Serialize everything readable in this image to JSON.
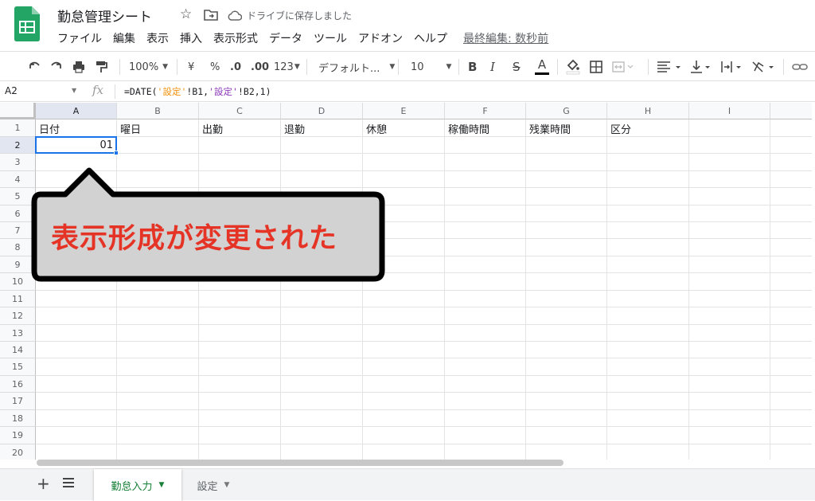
{
  "app": {
    "title": "勤怠管理シート",
    "save_status": "ドライブに保存しました",
    "menus": [
      "ファイル",
      "編集",
      "表示",
      "挿入",
      "表示形式",
      "データ",
      "ツール",
      "アドオン",
      "ヘルプ"
    ],
    "last_edit": "最終編集: 数秒前"
  },
  "toolbar": {
    "zoom": "100%",
    "currency": "¥",
    "percent": "%",
    "dec_decrease": ".0",
    "dec_increase": ".00",
    "number_format": "123",
    "font": "デフォルト...",
    "font_size": "10",
    "bold": "B",
    "italic": "I",
    "strike": "S",
    "text_color": "A"
  },
  "formula_bar": {
    "cell_ref": "A2",
    "fx": "fx",
    "formula_parts": [
      "=DATE(",
      "'設定'",
      "!B1,",
      "'設定'",
      "!B2,1)"
    ]
  },
  "grid": {
    "columns": [
      "A",
      "B",
      "C",
      "D",
      "E",
      "F",
      "G",
      "H",
      "I"
    ],
    "rows": [
      "1",
      "2",
      "3",
      "4",
      "5",
      "6",
      "7",
      "8",
      "9",
      "10",
      "11",
      "12",
      "13",
      "14",
      "15",
      "16",
      "17",
      "18",
      "19",
      "20"
    ],
    "header_row": [
      "日付",
      "曜日",
      "出勤",
      "退勤",
      "休憩",
      "稼働時間",
      "残業時間",
      "区分"
    ],
    "a2_value": "01",
    "selected_cell": "A2"
  },
  "annotation": {
    "text": "表示形成が変更された"
  },
  "sheets": {
    "add_label": "+",
    "tabs": [
      {
        "label": "勤怠入力",
        "active": true
      },
      {
        "label": "設定",
        "active": false
      }
    ]
  },
  "colors": {
    "accent": "#1a73e8",
    "sheets_green": "#188038",
    "callout_text": "#e53325",
    "formula_orange": "#f0900a",
    "formula_purple": "#8a3ab9"
  }
}
